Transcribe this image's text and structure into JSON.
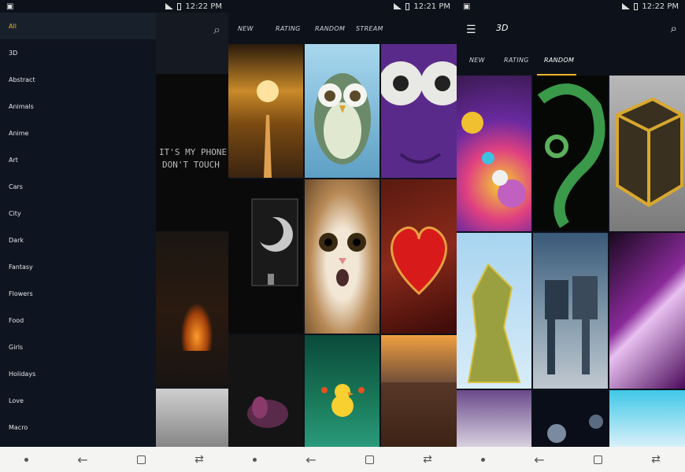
{
  "status_bars": [
    {
      "time": "12:22 PM"
    },
    {
      "time": "12:21 PM"
    },
    {
      "time": "12:22 PM"
    }
  ],
  "drawer": {
    "items": [
      "All",
      "3D",
      "Abstract",
      "Animals",
      "Anime",
      "Art",
      "Cars",
      "City",
      "Dark",
      "Fantasy",
      "Flowers",
      "Food",
      "Girls",
      "Holidays",
      "Love",
      "Macro"
    ]
  },
  "behind": {
    "phone_text_line1": "IT'S MY PHONE",
    "phone_text_line2": "DON'T TOUCH"
  },
  "screen2": {
    "tabs": [
      "NEW",
      "RATING",
      "RANDOM",
      "STREAM"
    ]
  },
  "screen3": {
    "title": "3D",
    "tabs": [
      "NEW",
      "RATING",
      "RANDOM"
    ],
    "active_tab": "RANDOM"
  },
  "colors": {
    "accent": "#f0b429"
  }
}
